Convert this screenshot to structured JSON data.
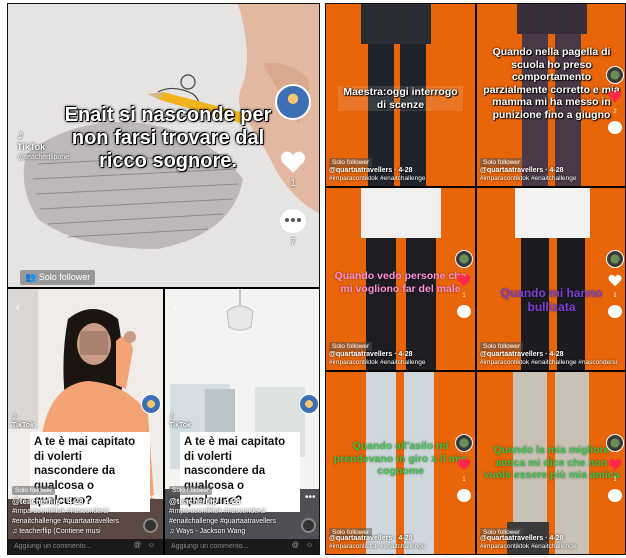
{
  "left_top": {
    "caption": "Enait si nasconde per non farsi trovare dal ricco sognore.",
    "tiktok_label": "TikTok",
    "handle_watermark": "@teacherflipone",
    "like_count": "1",
    "comment_count": "7",
    "badge": "Solo follower"
  },
  "left_bottom": [
    {
      "question": "A te è mai capitato di volerti nascondere da qualcosa o qualcuno?",
      "badge": "Solo follower",
      "username": "@teacherflip · 4-28",
      "hashtags_1": "#imparacontiktok #nascondersi",
      "hashtags_2": "#enaitchallenge #quartaatravellers",
      "music": "♫ teacherflip (Contiene musi",
      "comment_placeholder": "Aggiungi un commento...",
      "tiktok_label": "TikTok"
    },
    {
      "question": "A te è mai capitato di volerti nascondere da qualcosa o qualcuno?",
      "badge": "Solo follower",
      "username": "@teacherflip · 4-28",
      "hashtags_1": "#imparacontiktok #nascondersi",
      "hashtags_2": "#enaitchallenge #quartaatravellers",
      "music": "♫ Ways - Jackson Wang",
      "comment_placeholder": "Aggiungi un commento...",
      "tiktok_label": "TikTok"
    }
  ],
  "right_grid": [
    {
      "caption": "Maestra:oggi interrogo di scenze",
      "style": "white-on-orange",
      "username": "@quartaatravellers · 4-28",
      "hashtags": "#imparacontiktok #enaitchallenge",
      "badge": "Solo follower",
      "likes": "1"
    },
    {
      "caption": "Quando nella pagella di scuola ho preso comportamento parzialmente corretto e mia mamma mi ha messo in punizione fino a giugno",
      "style": "white",
      "username": "@quartaatravellers · 4-28",
      "hashtags": "#imparacontiktok #enaitchallenge",
      "badge": "Solo follower",
      "likes": "2"
    },
    {
      "caption": "Quando vedo persone che mi vogliono far del male",
      "style": "pink",
      "username": "@quartaatravellers · 4-28",
      "hashtags": "#imparacontiktok #enaitchallenge",
      "badge": "Solo follower",
      "likes": "1"
    },
    {
      "caption": "Quando mi hanno bullizata",
      "style": "purple",
      "username": "@quartaatravellers · 4-28",
      "hashtags": "#imparacontiktok #enaitchallenge #nascondersi",
      "badge": "Solo follower",
      "likes": "1"
    },
    {
      "caption": "Quando all'asilo mi prendevano in giro x il mio cognome",
      "style": "green",
      "username": "@quartaatravellers · 4-28",
      "hashtags": "#imparacontiktok #enaitchallenge",
      "badge": "Solo follower",
      "likes": "1"
    },
    {
      "caption": "Quando la mia migliore amica mi dice che non vuole essere più mia amica",
      "style": "green",
      "username": "@quartaatravellers · 4-28",
      "hashtags": "#imparacontiktok #enaitchallenge",
      "badge": "Solo follower",
      "likes": "1"
    }
  ],
  "colors": {
    "orange_bg": "#e8650a",
    "like_red": "#ff2a4a"
  }
}
